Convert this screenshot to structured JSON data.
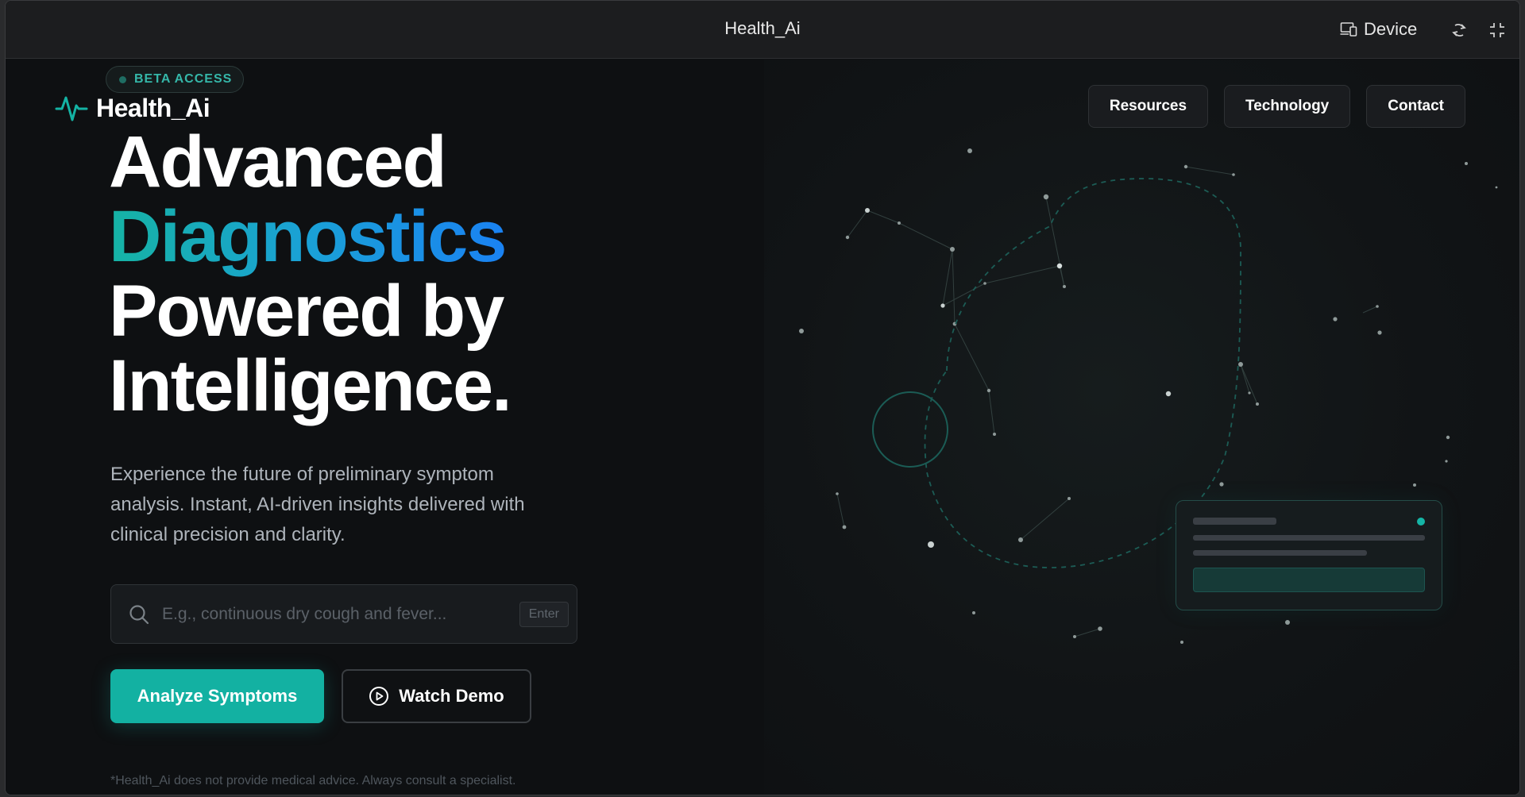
{
  "window": {
    "title": "Health_Ai",
    "device_label": "Device",
    "icons": [
      "device-icon",
      "rotate-icon",
      "exit-fullscreen-icon"
    ]
  },
  "badge": {
    "label": "BETA ACCESS"
  },
  "brand": {
    "name": "Health_Ai",
    "icon": "pulse-icon",
    "accent": "#14b3a4"
  },
  "nav": [
    {
      "label": "Resources"
    },
    {
      "label": "Technology"
    },
    {
      "label": "Contact"
    }
  ],
  "hero": {
    "line1": "Advanced",
    "line2": "Diagnostics",
    "line3": "Powered by",
    "line4": "Intelligence.",
    "gradient": [
      "#16b3a4",
      "#1a82f2"
    ],
    "description": "Experience the future of preliminary symptom analysis. Instant, AI-driven insights delivered with clinical precision and clarity."
  },
  "search": {
    "placeholder": "E.g., continuous dry cough and fever...",
    "value": "",
    "hint": "Enter"
  },
  "actions": {
    "primary_label": "Analyze Symptoms",
    "secondary_label": "Watch Demo",
    "primary_color": "#13b1a2"
  },
  "disclaimer": "*Health_Ai does not provide medical advice. Always consult a specialist."
}
